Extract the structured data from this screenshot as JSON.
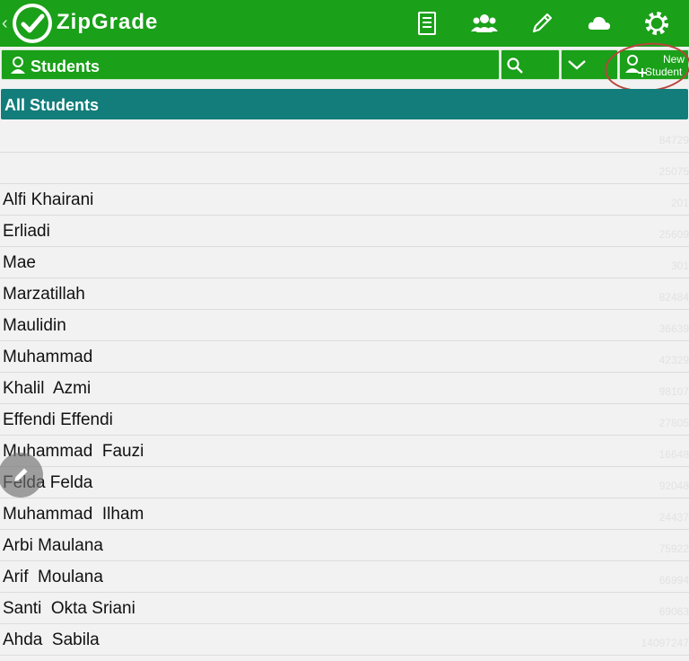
{
  "app": {
    "title": "ZipGrade"
  },
  "header": {
    "icons": [
      "clipboard-list-icon",
      "users-group-icon",
      "pencil-icon",
      "cloud-icon",
      "gear-icon"
    ]
  },
  "toolbar": {
    "title": "Students",
    "new_student_line1": "New",
    "new_student_line2": "Student"
  },
  "section": {
    "title": "All Students"
  },
  "students": [
    {
      "name": "",
      "id": "84729"
    },
    {
      "name": "",
      "id": "25075"
    },
    {
      "name": "Alfi Khairani",
      "id": "201"
    },
    {
      "name": "Erliadi",
      "id": "25609"
    },
    {
      "name": "Mae",
      "id": "301"
    },
    {
      "name": "Marzatillah",
      "id": "82484"
    },
    {
      "name": "Maulidin",
      "id": "36639"
    },
    {
      "name": "Muhammad",
      "id": "42329"
    },
    {
      "name": "Khalil  Azmi",
      "id": "98107"
    },
    {
      "name": "Effendi Effendi",
      "id": "27805"
    },
    {
      "name": "Muhammad  Fauzi",
      "id": "16648"
    },
    {
      "name": "Felda Felda",
      "id": "92048"
    },
    {
      "name": "Muhammad  Ilham",
      "id": "24437"
    },
    {
      "name": "Arbi Maulana",
      "id": "75922"
    },
    {
      "name": "Arif  Moulana",
      "id": "66994"
    },
    {
      "name": "Santi  Okta Sriani",
      "id": "69063"
    },
    {
      "name": "Ahda  Sabila",
      "id": "14097247"
    }
  ],
  "colors": {
    "brand_green": "#1aa019",
    "header_teal": "#127d7a",
    "annotation_red": "#b8453c"
  }
}
